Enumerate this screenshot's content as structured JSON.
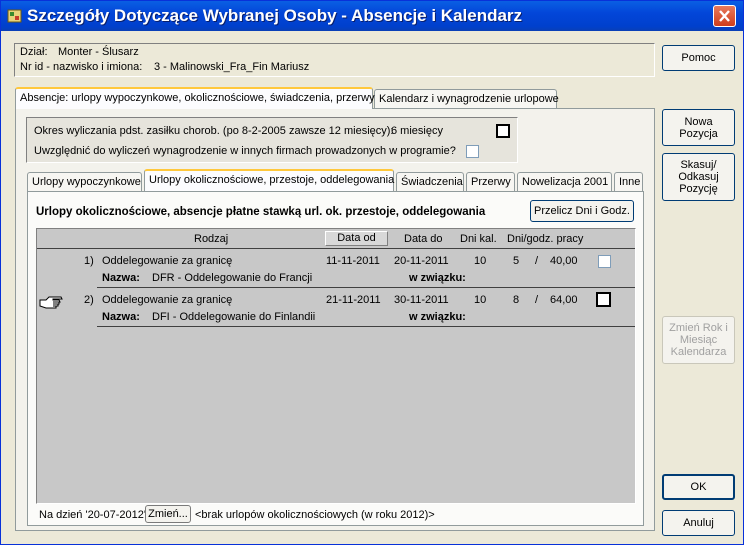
{
  "window": {
    "title": "Szczegóły Dotyczące Wybranej Osoby - Absencje i Kalendarz"
  },
  "info": {
    "dept_label": "Dział:",
    "dept_value": "Monter - Ślusarz",
    "id_label": "Nr id - nazwisko i imiona:",
    "id_value": "3 - Malinowski_Fra_Fin Mariusz"
  },
  "main_tabs": [
    {
      "label": "Absencje: urlopy wypoczynkowe, okolicznościowe, świadczenia, przerwy"
    },
    {
      "label": "Kalendarz i wynagrodzenie urlopowe"
    }
  ],
  "options": {
    "period_text": "Okres wyliczania pdst. zasiłku chorob. (po 8-2-2005 zawsze 12 miesięcy):",
    "period_value": "6 miesięcy",
    "include_text": "Uwzględnić do wyliczeń wynagrodzenie w innych firmach prowadzonych w programie?"
  },
  "sub_tabs": [
    {
      "label": "Urlopy wypoczynkowe"
    },
    {
      "label": "Urlopy okolicznościowe, przestoje, oddelegowania"
    },
    {
      "label": "Świadczenia"
    },
    {
      "label": "Przerwy"
    },
    {
      "label": "Nowelizacja 2001"
    },
    {
      "label": "Inne"
    }
  ],
  "section": {
    "heading": "Urlopy okolicznościowe, absencje płatne stawką url. ok. przestoje, oddelegowania",
    "recalc_button": "Przelicz Dni i Godz."
  },
  "table": {
    "headers": {
      "type": "Rodzaj",
      "date_from": "Data od",
      "date_to": "Data do",
      "days": "Dni kal.",
      "hours": "Dni/godz. pracy"
    },
    "name_label": "Nazwa:",
    "related_label": "w związku:",
    "rows": [
      {
        "num": "1)",
        "type": "Oddelegowanie za granicę",
        "date_from": "11-11-2011",
        "date_to": "20-11-2011",
        "days": "10",
        "work_days": "5",
        "slash": "/",
        "hours": "40,00",
        "name": "DFR - Oddelegowanie do Francji"
      },
      {
        "num": "2)",
        "type": "Oddelegowanie za granicę",
        "date_from": "21-11-2011",
        "date_to": "30-11-2011",
        "days": "10",
        "work_days": "8",
        "slash": "/",
        "hours": "64,00",
        "name": "DFI - Oddelegowanie do Finlandii"
      }
    ]
  },
  "footer": {
    "date_text": "Na dzień '20-07-2012'",
    "change_button": "Zmień...",
    "status_text": "<brak urlopów okolicznościowych (w roku 2012)>"
  },
  "side_buttons": {
    "help": "Pomoc",
    "new_position": "Nowa\nPozycja",
    "delete_position": "Skasuj/\nOdkasuj\nPozycję",
    "change_year": "Zmień Rok i\nMiesiąc\nKalendarza",
    "ok": "OK",
    "cancel": "Anuluj"
  },
  "colors": {
    "titlebar": "#0346d9",
    "dialog_bg": "#ece9d8",
    "grid_bg": "#c8c8c8",
    "tab_highlight": "#ffc83c"
  }
}
